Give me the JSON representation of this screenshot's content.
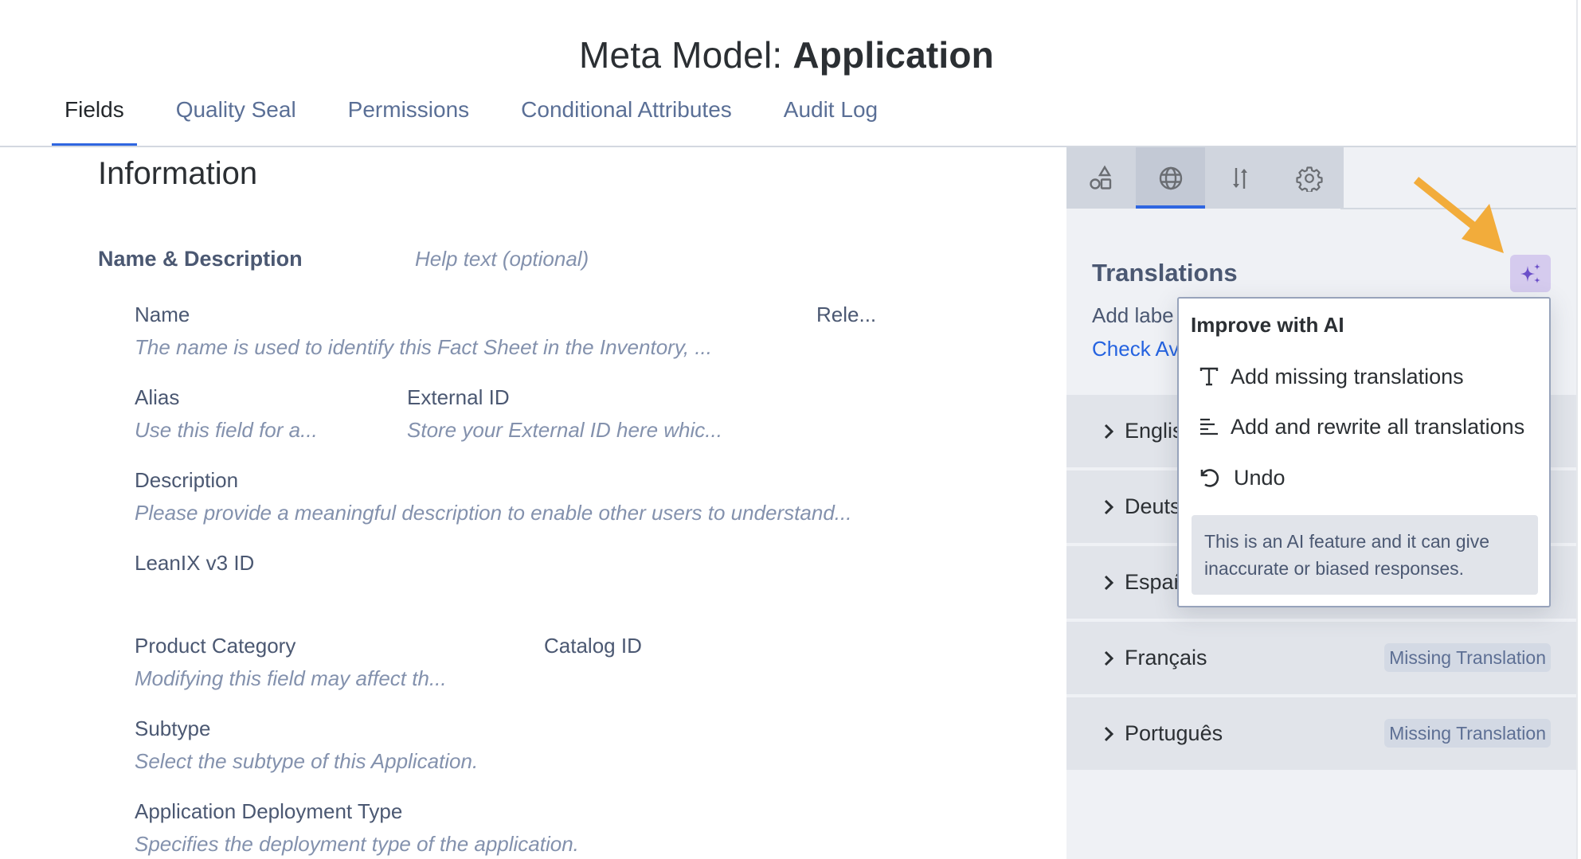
{
  "header": {
    "title_prefix": "Meta Model: ",
    "title_name": "Application"
  },
  "tabs": [
    {
      "label": "Fields",
      "active": true
    },
    {
      "label": "Quality Seal",
      "active": false
    },
    {
      "label": "Permissions",
      "active": false
    },
    {
      "label": "Conditional Attributes",
      "active": false
    },
    {
      "label": "Audit Log",
      "active": false
    }
  ],
  "content": {
    "section_title": "Information",
    "group": {
      "title": "Name & Description",
      "help_placeholder": "Help text (optional)"
    },
    "fields": {
      "name": {
        "label": "Name",
        "hint": "The name is used to identify this Fact Sheet in the Inventory, ..."
      },
      "release": {
        "label": "Rele..."
      },
      "alias": {
        "label": "Alias",
        "hint": "Use this field for a..."
      },
      "external_id": {
        "label": "External ID",
        "hint": "Store your External ID here whic..."
      },
      "description": {
        "label": "Description",
        "hint": "Please provide a meaningful description to enable other users to understand..."
      },
      "leanix_v3_id": {
        "label": "LeanIX v3 ID"
      },
      "product_category": {
        "label": "Product Category",
        "hint": "Modifying this field may affect th..."
      },
      "catalog_id": {
        "label": "Catalog ID"
      },
      "subtype": {
        "label": "Subtype",
        "hint": "Select the subtype of this Application."
      },
      "deployment_type": {
        "label": "Application Deployment Type",
        "hint": "Specifies the deployment type of the application."
      }
    }
  },
  "panel": {
    "tabs": [
      {
        "icon": "shapes-icon",
        "active": false
      },
      {
        "icon": "globe-icon",
        "active": true
      },
      {
        "icon": "sort-arrows-icon",
        "active": false
      },
      {
        "icon": "gear-icon",
        "active": false
      }
    ],
    "translations_title": "Translations",
    "description_visible": "Add labe",
    "link_visible": "Check Av",
    "ai_button_icon": "sparkle-icon",
    "languages": [
      {
        "name": "English",
        "visible_name": "Englis",
        "badge": ""
      },
      {
        "name": "Deutsch",
        "visible_name": "Deuts",
        "badge": ""
      },
      {
        "name": "Español",
        "visible_name": "Españ",
        "badge": ""
      },
      {
        "name": "Français",
        "visible_name": "Français",
        "badge": "Missing Translation"
      },
      {
        "name": "Português",
        "visible_name": "Português",
        "badge": "Missing Translation"
      }
    ]
  },
  "ai_menu": {
    "title": "Improve with AI",
    "items": [
      {
        "icon": "text-icon",
        "label": "Add missing translations"
      },
      {
        "icon": "align-left-icon",
        "label": "Add and rewrite all translations"
      },
      {
        "icon": "undo-icon",
        "label": "Undo"
      }
    ],
    "disclaimer": "This is an AI feature and it can give inaccurate or biased responses."
  },
  "colors": {
    "accent": "#2f66e0",
    "ai_purple": "#6b4fc9",
    "ai_button_bg": "#d5cbee",
    "annotation_arrow": "#f2ac3b",
    "link": "#2563e0"
  }
}
